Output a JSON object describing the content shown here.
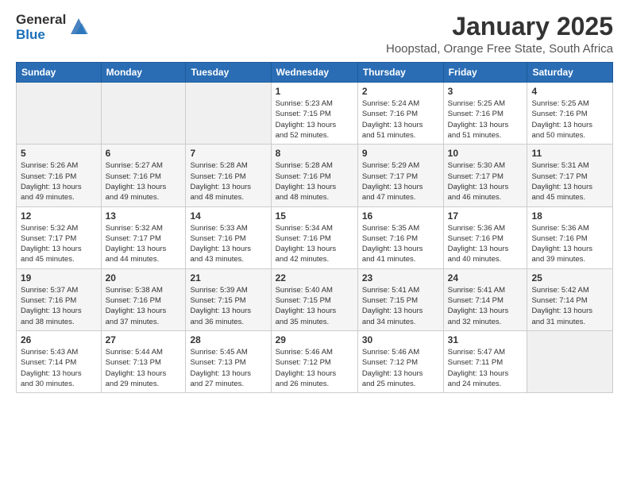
{
  "logo": {
    "general": "General",
    "blue": "Blue"
  },
  "header": {
    "month": "January 2025",
    "location": "Hoopstad, Orange Free State, South Africa"
  },
  "weekdays": [
    "Sunday",
    "Monday",
    "Tuesday",
    "Wednesday",
    "Thursday",
    "Friday",
    "Saturday"
  ],
  "weeks": [
    [
      {
        "day": "",
        "info": ""
      },
      {
        "day": "",
        "info": ""
      },
      {
        "day": "",
        "info": ""
      },
      {
        "day": "1",
        "info": "Sunrise: 5:23 AM\nSunset: 7:15 PM\nDaylight: 13 hours\nand 52 minutes."
      },
      {
        "day": "2",
        "info": "Sunrise: 5:24 AM\nSunset: 7:16 PM\nDaylight: 13 hours\nand 51 minutes."
      },
      {
        "day": "3",
        "info": "Sunrise: 5:25 AM\nSunset: 7:16 PM\nDaylight: 13 hours\nand 51 minutes."
      },
      {
        "day": "4",
        "info": "Sunrise: 5:25 AM\nSunset: 7:16 PM\nDaylight: 13 hours\nand 50 minutes."
      }
    ],
    [
      {
        "day": "5",
        "info": "Sunrise: 5:26 AM\nSunset: 7:16 PM\nDaylight: 13 hours\nand 49 minutes."
      },
      {
        "day": "6",
        "info": "Sunrise: 5:27 AM\nSunset: 7:16 PM\nDaylight: 13 hours\nand 49 minutes."
      },
      {
        "day": "7",
        "info": "Sunrise: 5:28 AM\nSunset: 7:16 PM\nDaylight: 13 hours\nand 48 minutes."
      },
      {
        "day": "8",
        "info": "Sunrise: 5:28 AM\nSunset: 7:16 PM\nDaylight: 13 hours\nand 48 minutes."
      },
      {
        "day": "9",
        "info": "Sunrise: 5:29 AM\nSunset: 7:17 PM\nDaylight: 13 hours\nand 47 minutes."
      },
      {
        "day": "10",
        "info": "Sunrise: 5:30 AM\nSunset: 7:17 PM\nDaylight: 13 hours\nand 46 minutes."
      },
      {
        "day": "11",
        "info": "Sunrise: 5:31 AM\nSunset: 7:17 PM\nDaylight: 13 hours\nand 45 minutes."
      }
    ],
    [
      {
        "day": "12",
        "info": "Sunrise: 5:32 AM\nSunset: 7:17 PM\nDaylight: 13 hours\nand 45 minutes."
      },
      {
        "day": "13",
        "info": "Sunrise: 5:32 AM\nSunset: 7:17 PM\nDaylight: 13 hours\nand 44 minutes."
      },
      {
        "day": "14",
        "info": "Sunrise: 5:33 AM\nSunset: 7:16 PM\nDaylight: 13 hours\nand 43 minutes."
      },
      {
        "day": "15",
        "info": "Sunrise: 5:34 AM\nSunset: 7:16 PM\nDaylight: 13 hours\nand 42 minutes."
      },
      {
        "day": "16",
        "info": "Sunrise: 5:35 AM\nSunset: 7:16 PM\nDaylight: 13 hours\nand 41 minutes."
      },
      {
        "day": "17",
        "info": "Sunrise: 5:36 AM\nSunset: 7:16 PM\nDaylight: 13 hours\nand 40 minutes."
      },
      {
        "day": "18",
        "info": "Sunrise: 5:36 AM\nSunset: 7:16 PM\nDaylight: 13 hours\nand 39 minutes."
      }
    ],
    [
      {
        "day": "19",
        "info": "Sunrise: 5:37 AM\nSunset: 7:16 PM\nDaylight: 13 hours\nand 38 minutes."
      },
      {
        "day": "20",
        "info": "Sunrise: 5:38 AM\nSunset: 7:16 PM\nDaylight: 13 hours\nand 37 minutes."
      },
      {
        "day": "21",
        "info": "Sunrise: 5:39 AM\nSunset: 7:15 PM\nDaylight: 13 hours\nand 36 minutes."
      },
      {
        "day": "22",
        "info": "Sunrise: 5:40 AM\nSunset: 7:15 PM\nDaylight: 13 hours\nand 35 minutes."
      },
      {
        "day": "23",
        "info": "Sunrise: 5:41 AM\nSunset: 7:15 PM\nDaylight: 13 hours\nand 34 minutes."
      },
      {
        "day": "24",
        "info": "Sunrise: 5:41 AM\nSunset: 7:14 PM\nDaylight: 13 hours\nand 32 minutes."
      },
      {
        "day": "25",
        "info": "Sunrise: 5:42 AM\nSunset: 7:14 PM\nDaylight: 13 hours\nand 31 minutes."
      }
    ],
    [
      {
        "day": "26",
        "info": "Sunrise: 5:43 AM\nSunset: 7:14 PM\nDaylight: 13 hours\nand 30 minutes."
      },
      {
        "day": "27",
        "info": "Sunrise: 5:44 AM\nSunset: 7:13 PM\nDaylight: 13 hours\nand 29 minutes."
      },
      {
        "day": "28",
        "info": "Sunrise: 5:45 AM\nSunset: 7:13 PM\nDaylight: 13 hours\nand 27 minutes."
      },
      {
        "day": "29",
        "info": "Sunrise: 5:46 AM\nSunset: 7:12 PM\nDaylight: 13 hours\nand 26 minutes."
      },
      {
        "day": "30",
        "info": "Sunrise: 5:46 AM\nSunset: 7:12 PM\nDaylight: 13 hours\nand 25 minutes."
      },
      {
        "day": "31",
        "info": "Sunrise: 5:47 AM\nSunset: 7:11 PM\nDaylight: 13 hours\nand 24 minutes."
      },
      {
        "day": "",
        "info": ""
      }
    ]
  ]
}
